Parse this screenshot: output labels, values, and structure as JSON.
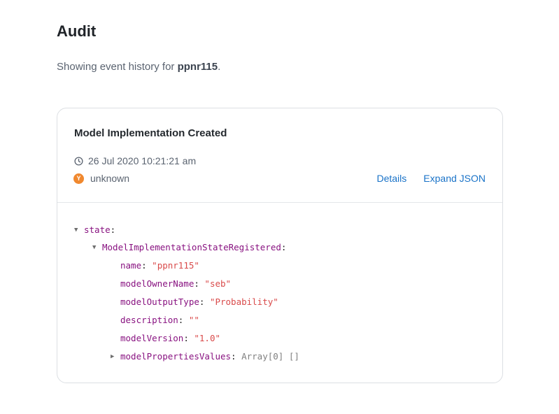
{
  "page": {
    "title": "Audit",
    "subtitle_prefix": "Showing event history for ",
    "subtitle_entity": "ppnr115",
    "subtitle_suffix": "."
  },
  "event": {
    "title": "Model Implementation Created",
    "timestamp": "26 Jul 2020 10:21:21 am",
    "user_initial": "Y",
    "user": "unknown",
    "actions": {
      "details": "Details",
      "expand_json": "Expand JSON"
    }
  },
  "json_tree": {
    "root_key": "state",
    "child_key": "ModelImplementationStateRegistered",
    "fields": [
      {
        "key": "name",
        "value": "\"ppnr115\""
      },
      {
        "key": "modelOwnerName",
        "value": "\"seb\""
      },
      {
        "key": "modelOutputType",
        "value": "\"Probability\""
      },
      {
        "key": "description",
        "value": "\"\""
      },
      {
        "key": "modelVersion",
        "value": "\"1.0\""
      }
    ],
    "collapsed_field": {
      "key": "modelPropertiesValues",
      "summary": "Array[0] []"
    }
  },
  "colors": {
    "link": "#1a73c8",
    "avatar": "#f0882e",
    "json_key": "#881280",
    "json_string": "#c80000"
  },
  "icons": {
    "time": "clock-icon",
    "user": "avatar",
    "expanded": "triangle-down-icon",
    "collapsed": "triangle-right-icon"
  }
}
